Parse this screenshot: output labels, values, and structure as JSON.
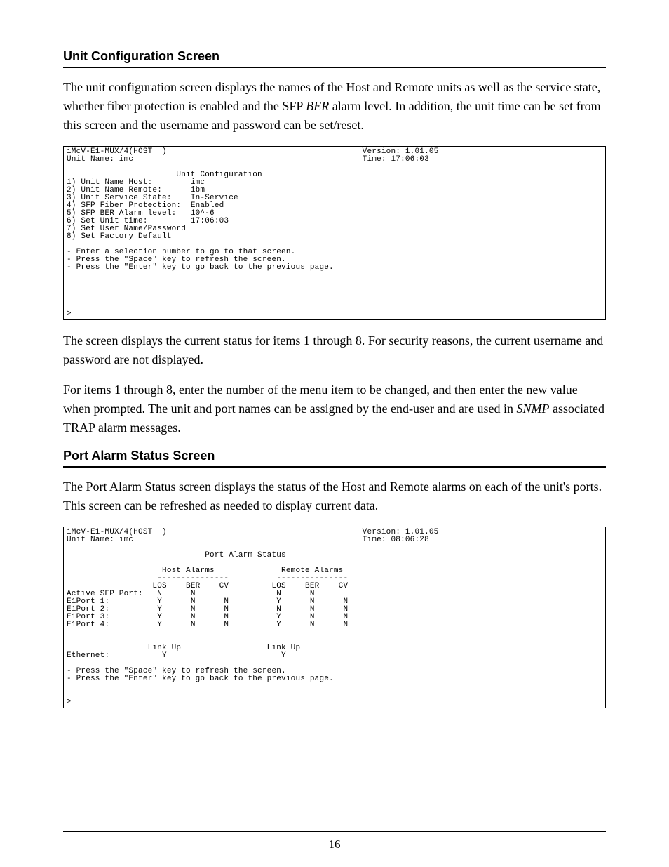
{
  "section1": {
    "heading": "Unit Configuration Screen",
    "para1_a": "The unit configuration screen displays the names of the Host and Remote units as well as the service state, whether fiber protection is enabled and the SFP ",
    "para1_b": "BER",
    "para1_c": " alarm level.  In addition, the unit time can be set from this screen and the username and password can be set/reset.",
    "terminal": "iMcV-E1-MUX/4(HOST  )                                         Version: 1.01.05\nUnit Name: imc                                                Time: 17:06:03\n\n                       Unit Configuration\n1) Unit Name Host:        imc\n2) Unit Name Remote:      ibm\n3) Unit Service State:    In-Service\n4) SFP Fiber Protection:  Enabled\n5) SFP BER Alarm level:   10^-6\n6) Set Unit time:         17:06:03\n7) Set User Name/Password\n8) Set Factory Default\n\n- Enter a selection number to go to that screen.\n- Press the \"Space\" key to refresh the screen.\n- Press the \"Enter\" key to go back to the previous page.\n\n\n\n\n\n>",
    "para2": "The screen displays the current status for items 1 through 8.  For security reasons, the current username and password are not displayed.",
    "para3_a": "For items 1 through 8, enter the number of the menu item to be changed, and then enter the new value when prompted.  The unit and port names can be assigned by the end-user and are used in ",
    "para3_b": "SNMP",
    "para3_c": " associated TRAP alarm messages."
  },
  "section2": {
    "heading": "Port Alarm Status Screen",
    "para1": "The Port Alarm Status screen displays the status of the Host and Remote alarms on each of the unit's ports.  This screen can be refreshed as needed to display current data.",
    "terminal": "iMcV-E1-MUX/4(HOST  )                                         Version: 1.01.05\nUnit Name: imc                                                Time: 08:06:28\n\n                             Port Alarm Status\n\n                    Host Alarms              Remote Alarms\n                   ---------------          ---------------\n                  LOS    BER    CV         LOS    BER    CV\nActive SFP Port:   N      N                 N      N\nE1Port 1:          Y      N      N          Y      N      N\nE1Port 2:          Y      N      N          N      N      N\nE1Port 3:          Y      N      N          Y      N      N\nE1Port 4:          Y      N      N          Y      N      N\n\n\n                 Link Up                  Link Up\nEthernet:           Y                        Y\n\n- Press the \"Space\" key to refresh the screen.\n- Press the \"Enter\" key to go back to the previous page.\n\n\n>"
  },
  "page_number": "16"
}
